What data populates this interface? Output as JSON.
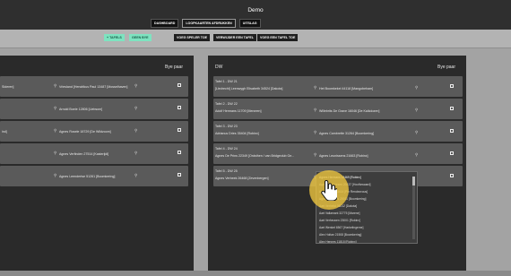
{
  "app": {
    "title": "Demo"
  },
  "nav": [
    {
      "label": "DASHBOARD"
    },
    {
      "label": "LOOPKAARTEN AFDRUKKEN"
    },
    {
      "label": "UITSLAG"
    }
  ],
  "toolbar": {
    "add_table": "+ TAFELS",
    "no_bye": "GEEN BYE",
    "add_player": "VOEG SPELER TOE",
    "remove_table": "VERWIJDER EEN TAFEL",
    "add_table_long": "VOEG EEN TAFEL TOE"
  },
  "left_panel": {
    "head_right": "Bye paar",
    "rows": [
      {
        "cell1": "Sideren]",
        "cell2": "Vriesland [Hendrikus Paul 13487 [Mosselhaven]"
      },
      {
        "cell1": "",
        "cell2": "Arnold Boele 12806 [Liebsom]"
      },
      {
        "cell1": "ind]",
        "cell2": "Agnes Rosele 18729 [De Wildzoom]"
      },
      {
        "cell1": "",
        "cell2": "Agnes Verfinden 27514 [Kasterijdi]"
      },
      {
        "cell1": "",
        "cell2": "Agnes Leendertse 51261 [Boomkering]"
      }
    ]
  },
  "right_panel": {
    "head_left": "DW",
    "head_right": "Bye paar",
    "rows": [
      {
        "line1": "Tafel 1 - DW 21",
        "line2": "[Liedrecht] Leenwygh Elisabeth 34524 [Dakota]",
        "line3": "Het Boomkekel 44118 [Mangobeham]"
      },
      {
        "line1": "Tafel 2 - DW 22",
        "line2": "Adolf Hermans 11709 [Merzeen]",
        "line3": "Willebrits De Grave 16046 [De Kalkdozen]"
      },
      {
        "line1": "Tafel 3 - DW 23",
        "line2": "Adrianus Dries 35404 [Robinx]",
        "line3": "Agnes Cambrette 31264 [Boomkering]"
      },
      {
        "line1": "Tafel 4 - DW 24",
        "line2": "Agnes De Prins 22349 [Ordsthen / van Bridgeclub Ge...",
        "line3": "Agnes Leunissens 21663 [Robinx]"
      },
      {
        "line1": "Tafel 5 - DW 25",
        "line2": "Agnes Verbeek 26468 [Zevenbergen]",
        "line3": ""
      }
    ]
  },
  "dropdown": {
    "items": [
      "Agnes Hermans 16469 [Robinx]",
      "Agnes Verheezen 20437 [Hooftzwaard]",
      "Aart Verwer 23414 [Pin Rendezvous]",
      "Agnes Schoofs 20011 [Boomkering]",
      "Aart Verhelst 36012 [Dakota]",
      "Aart Vallamant 32775 [Marene]",
      "Aart Verheuven 23001 [Robinx]",
      "Aart Wenkel 6567 [Harkelingerne]",
      "Alex Holtan 21508 [Boomkering]",
      "Alex Hennes 11818 [Robinx]"
    ]
  },
  "colors": {
    "accent_green": "#7ee3c0",
    "highlight": "#ecc43e"
  }
}
